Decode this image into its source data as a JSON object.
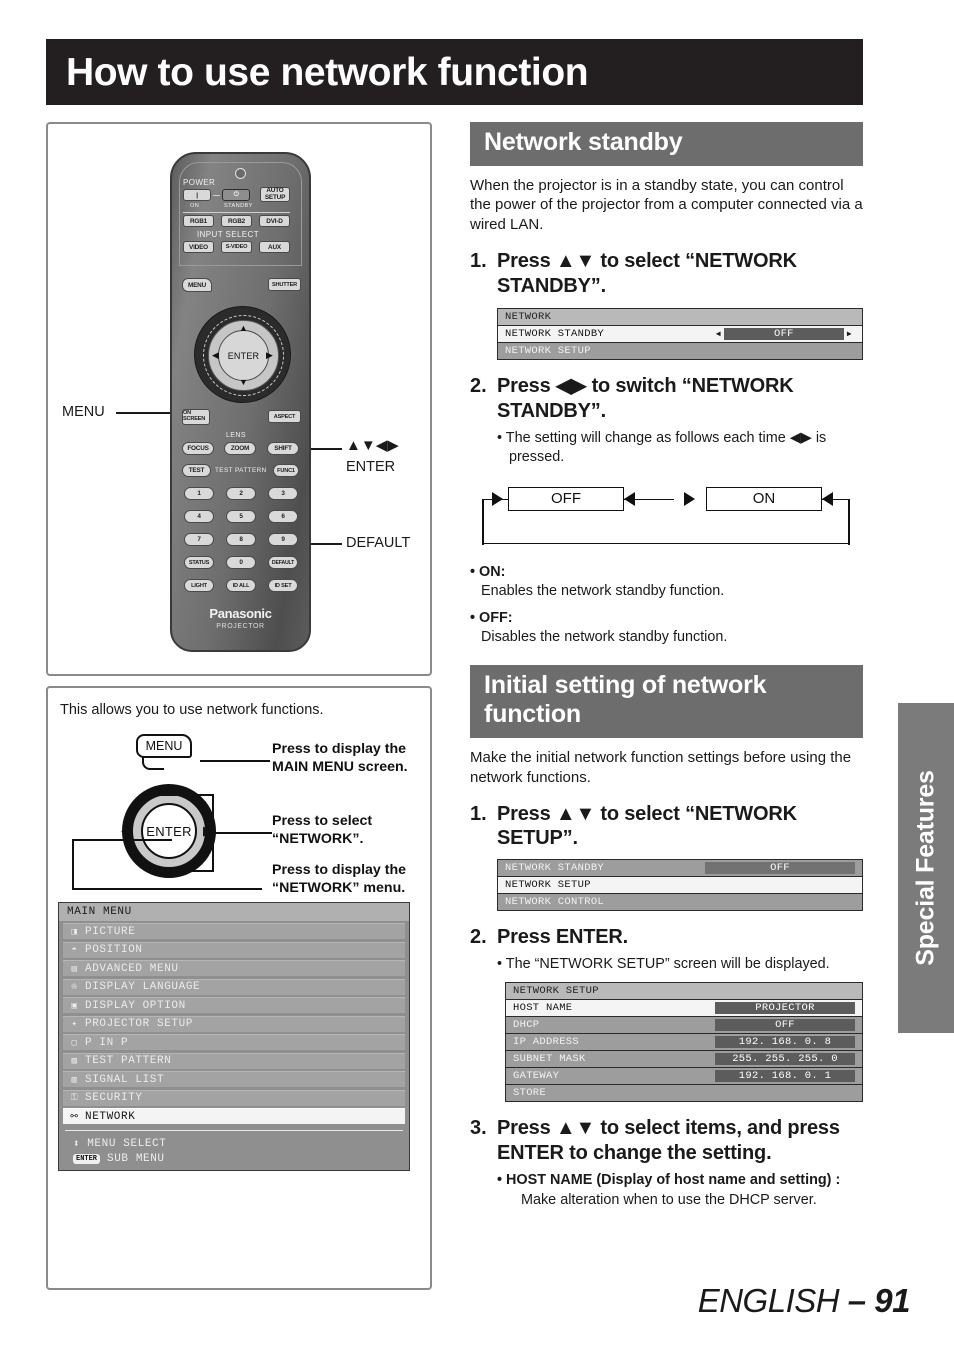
{
  "page": {
    "title": "How to use network function",
    "footer_language": "ENGLISH",
    "footer_separator": "–",
    "footer_page": "91",
    "side_tab": "Special Features"
  },
  "remote_figure": {
    "callouts": {
      "menu": "MENU",
      "arrows": "▲▼◀▶",
      "enter": "ENTER",
      "default": "DEFAULT"
    },
    "remote": {
      "power_label": "POWER",
      "power_on": "ON",
      "power_standby": "STANDBY",
      "auto_setup": "AUTO SETUP",
      "input_select": "INPUT SELECT",
      "inputs_row1": [
        "RGB1",
        "RGB2",
        "DVI-D"
      ],
      "inputs_row2": [
        "VIDEO",
        "S-VIDEO",
        "AUX"
      ],
      "menu_btn": "MENU",
      "shutter_btn": "SHUTTER",
      "enter_btn": "ENTER",
      "on_screen_btn": "ON SCREEN",
      "aspect_btn": "ASPECT",
      "lens_label": "LENS",
      "lens_btns": [
        "FOCUS",
        "ZOOM",
        "SHIFT"
      ],
      "test_btn": "TEST",
      "test_pattern_label": "TEST PATTERN",
      "func1_btn": "FUNC1",
      "numpad": [
        "1",
        "2",
        "3",
        "4",
        "5",
        "6",
        "7",
        "8",
        "9"
      ],
      "status_btn": "STATUS",
      "zero_btn": "0",
      "default_btn": "DEFAULT",
      "light_btn": "LIGHT",
      "id_all_btn": "ID ALL",
      "id_set_btn": "ID SET",
      "brand": "Panasonic",
      "brand_sub": "PROJECTOR"
    }
  },
  "howto": {
    "intro": "This allows you to use network functions.",
    "menu_key_label": "MENU",
    "enter_wheel_label": "ENTER",
    "note_menu": "Press to display the MAIN MENU screen.",
    "note_select": "Press to select “NETWORK”.",
    "note_display": "Press to display the “NETWORK” menu.",
    "main_menu": {
      "title": "MAIN MENU",
      "items": [
        {
          "icon": "picture-icon",
          "glyph": "◨",
          "label": "PICTURE",
          "selected": false
        },
        {
          "icon": "position-icon",
          "glyph": "◓",
          "label": "POSITION",
          "selected": false
        },
        {
          "icon": "advanced-menu-icon",
          "glyph": "▤",
          "label": "ADVANCED MENU",
          "selected": false
        },
        {
          "icon": "display-language-icon",
          "glyph": "✇",
          "label": "DISPLAY LANGUAGE",
          "selected": false
        },
        {
          "icon": "display-option-icon",
          "glyph": "▣",
          "label": "DISPLAY OPTION",
          "selected": false
        },
        {
          "icon": "projector-setup-icon",
          "glyph": "✦",
          "label": "PROJECTOR SETUP",
          "selected": false
        },
        {
          "icon": "p-in-p-icon",
          "glyph": "▢",
          "label": "P IN P",
          "selected": false
        },
        {
          "icon": "test-pattern-icon",
          "glyph": "▨",
          "label": "TEST PATTERN",
          "selected": false
        },
        {
          "icon": "signal-list-icon",
          "glyph": "▥",
          "label": "SIGNAL LIST",
          "selected": false
        },
        {
          "icon": "security-icon",
          "glyph": "⚿",
          "label": "SECURITY",
          "selected": false
        },
        {
          "icon": "network-icon",
          "glyph": "⚯",
          "label": "NETWORK",
          "selected": true
        }
      ],
      "footer_select_icon": "up-down-arrow-icon",
      "footer_select_glyph": "⬍",
      "footer_select": "MENU SELECT",
      "footer_enter_key": "ENTER",
      "footer_enter": "SUB MENU"
    }
  },
  "network_standby": {
    "heading": "Network standby",
    "intro": "When the projector is in a standby state, you can control the power of the projector from a computer connected via a wired LAN.",
    "step1_num": "1.",
    "step1_text": "Press ▲▼ to select “NETWORK STANDBY”.",
    "osd1": {
      "title": "NETWORK",
      "rows": [
        {
          "label": "NETWORK  STANDBY",
          "value": "OFF",
          "active": true,
          "arrows": true
        },
        {
          "label": "NETWORK  SETUP",
          "value": "",
          "active": false,
          "arrows": false
        }
      ]
    },
    "step2_num": "2.",
    "step2_text": "Press ◀▶ to switch “NETWORK STANDBY”.",
    "step2_bullet": "• The setting will change as follows each time ◀▶ is pressed.",
    "cycle": {
      "left": "OFF",
      "right": "ON"
    },
    "on_label": "• ON:",
    "on_desc": "Enables the network standby function.",
    "off_label": "• OFF:",
    "off_desc": "Disables the network standby function."
  },
  "initial_setting": {
    "heading": "Initial setting of network function",
    "intro": "Make the initial network function settings before using the network functions.",
    "step1_num": "1.",
    "step1_text": "Press ▲▼ to select “NETWORK SETUP”.",
    "osd2": {
      "rows": [
        {
          "label": "NETWORK  STANDBY",
          "value": "OFF",
          "active": false
        },
        {
          "label": "NETWORK  SETUP",
          "value": "",
          "active": true
        },
        {
          "label": "NETWORK  CONTROL",
          "value": "",
          "active": false
        }
      ]
    },
    "step2_num": "2.",
    "step2_text": "Press ENTER.",
    "step2_bullet": "• The “NETWORK SETUP” screen will be displayed.",
    "osd3": {
      "title": "NETWORK  SETUP",
      "rows": [
        {
          "label": "HOST NAME",
          "value": "PROJECTOR",
          "active": true
        },
        {
          "label": "DHCP",
          "value": "OFF",
          "active": false
        },
        {
          "label": "IP ADDRESS",
          "value": "192. 168.   0.   8",
          "active": false
        },
        {
          "label": "SUBNET MASK",
          "value": "255. 255. 255.   0",
          "active": false
        },
        {
          "label": "GATEWAY",
          "value": "192. 168.   0.   1",
          "active": false
        },
        {
          "label": "STORE",
          "value": "",
          "active": false
        }
      ]
    },
    "step3_num": "3.",
    "step3_text": "Press ▲▼ to select items, and press ENTER to change the setting.",
    "step3_bullet_bold": "• HOST NAME (Display of host name and setting) :",
    "step3_bullet_desc": "Make alteration when to use the DHCP server."
  },
  "colors": {
    "title_bar": "#231f20",
    "section_heading": "#6d6d6d",
    "side_tab": "#7b7b7b",
    "osd_value": "#5c5c5c"
  }
}
